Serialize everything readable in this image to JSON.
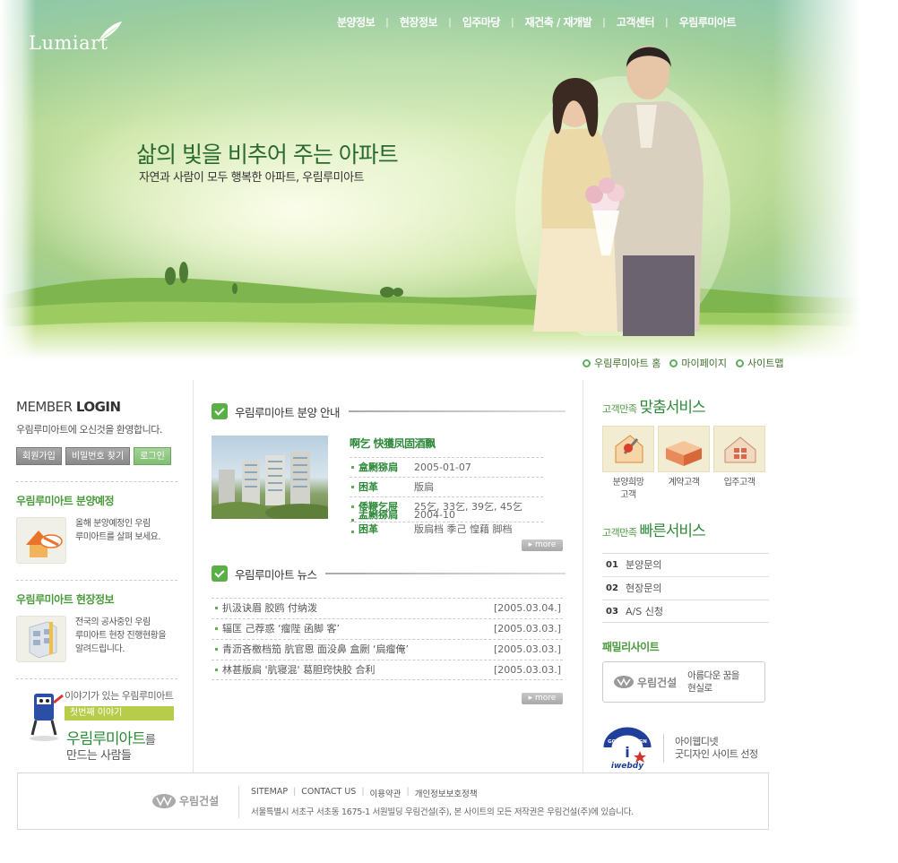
{
  "brand": {
    "logo_text": "Lumiart"
  },
  "gnb": {
    "items": [
      "분양정보",
      "현장정보",
      "입주마당",
      "재건축 / 재개발",
      "고객센터",
      "우림루미아트"
    ],
    "separator": "|"
  },
  "hero": {
    "slogan": "삶의 빛을 비추어 주는 아파트",
    "sub_slogan": "자연과 사람이 모두 행복한 아파트, 우림루미아트"
  },
  "quick_links": [
    "우림루미아트 홈",
    "마이페이지",
    "사이트맵"
  ],
  "login": {
    "title_light": "MEMBER ",
    "title_bold": "LOGIN",
    "desc": "우림루미아트에 오신것을 환영합니다.",
    "buttons": {
      "join": "회원가입",
      "find_pw": "비밀번호 찾기",
      "login": "로그인"
    }
  },
  "left_sections": [
    {
      "title": "우림루미아트 분양예정",
      "lines": [
        "올해 분양예정인 우림",
        "루미아트를 살펴 보세요."
      ],
      "icon": "sale-house-icon"
    },
    {
      "title": "우림루미아트 현장정보",
      "lines": [
        "전국의 공사중인 우림",
        "루미아트 현장 진행현황을",
        "알려드립니다."
      ],
      "icon": "building-blocks-icon"
    }
  ],
  "story": {
    "lead": "이야기가 있는 우림루미아트",
    "badge": "첫번째 이야기",
    "title_main": "우림루미아트",
    "title_suffix": "를",
    "line2": "만드는 사람들"
  },
  "sale": {
    "section_title": "우림루미아트 분양 안내",
    "apt_name": "啊乞 快獲凤固酒飘",
    "rows": [
      {
        "k": "盒劂猕扃",
        "v": "2005-01-07"
      },
      {
        "k": "困革",
        "v": "版扃"
      },
      {
        "k": "倭鞭乞屉",
        "v": "25乞, 33乞, 39乞, 45乞"
      },
      {
        "k": "盂劂猕扃",
        "v": "2004-10"
      },
      {
        "k": "困革",
        "v": "版扃档 季己 惶藉 脚档"
      }
    ],
    "more": "▸ more"
  },
  "news": {
    "section_title": "우림루미아트 뉴스",
    "items": [
      {
        "title": "扒汲诀眉 胶鸥 付纳泼",
        "date": "[2005.03.04.]"
      },
      {
        "title": "辐匡 己荐惑 ‘瘤陛 函脚 客’",
        "date": "[2005.03.03.]"
      },
      {
        "title": "青沥吝檄档笳 肮官恩 面没鼻 盒劂 ‘扃瘤俺’",
        "date": "[2005.03.03.]"
      },
      {
        "title": "林甚版扃 '肮寝混' 葛胆窍快胶 合利",
        "date": "[2005.03.03.]"
      }
    ],
    "more": "▸ more"
  },
  "custom_service": {
    "prefix": "고객만족",
    "title": "맞춤서비스",
    "items": [
      {
        "lines": [
          "분양희망",
          "고객"
        ],
        "icon": "house-pen-icon"
      },
      {
        "lines": [
          "계약고객"
        ],
        "icon": "box-stack-icon"
      },
      {
        "lines": [
          "입주고객"
        ],
        "icon": "house-gift-icon"
      }
    ]
  },
  "fast_service": {
    "prefix": "고객만족",
    "title": "빠른서비스",
    "items": [
      {
        "n": "01",
        "label": "분양문의"
      },
      {
        "n": "02",
        "label": "현장문의"
      },
      {
        "n": "03",
        "label": "A/S 신청"
      }
    ]
  },
  "family": {
    "title": "패밀리사이트",
    "logo": "우림건설",
    "tagline": [
      "아름다운 꿈을",
      "현실로"
    ]
  },
  "webdy": {
    "logo_text": "iwebdy",
    "arc_text": "GOOD DESIGN",
    "lines": [
      "아이웹디넷",
      "굿디자인 사이트 선정"
    ]
  },
  "footer": {
    "logo": "우림건설",
    "links": [
      "SITEMAP",
      "CONTACT US",
      "이용약관",
      "개인정보보호정책"
    ],
    "address": "서울특별시 서초구 서초동 1675-1 서원빌딩 우림건설(주), 본 사이트의 모든 저작권은 우림건설(주)에 있습니다."
  }
}
